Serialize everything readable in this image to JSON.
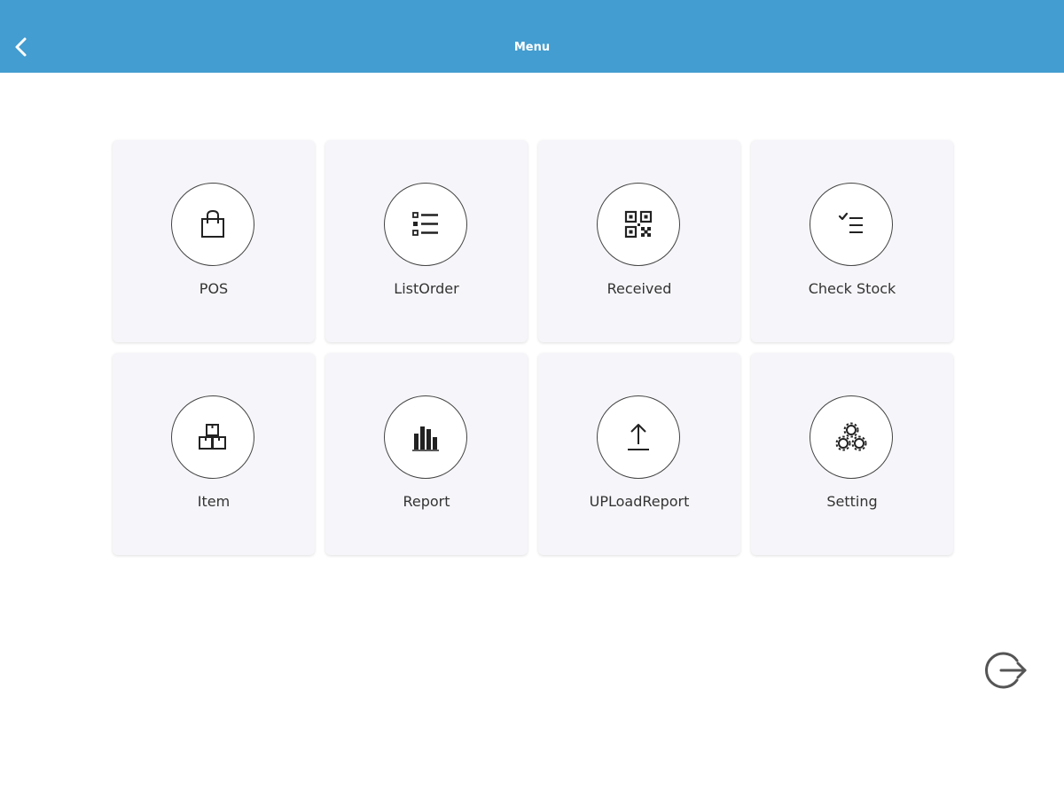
{
  "header": {
    "title": "Menu",
    "background_color": "#439dd0",
    "back_icon": "chevron-left-icon"
  },
  "menu": {
    "items": [
      {
        "label": "POS",
        "icon": "shopping-bag-icon"
      },
      {
        "label": "ListOrder",
        "icon": "list-icon"
      },
      {
        "label": "Received",
        "icon": "qr-code-icon"
      },
      {
        "label": "Check Stock",
        "icon": "checklist-icon"
      },
      {
        "label": "Item",
        "icon": "boxes-icon"
      },
      {
        "label": "Report",
        "icon": "bar-chart-icon"
      },
      {
        "label": "UPLoadReport",
        "icon": "upload-icon"
      },
      {
        "label": "Setting",
        "icon": "gears-icon"
      }
    ]
  },
  "footer": {
    "logout_icon": "logout-icon"
  }
}
